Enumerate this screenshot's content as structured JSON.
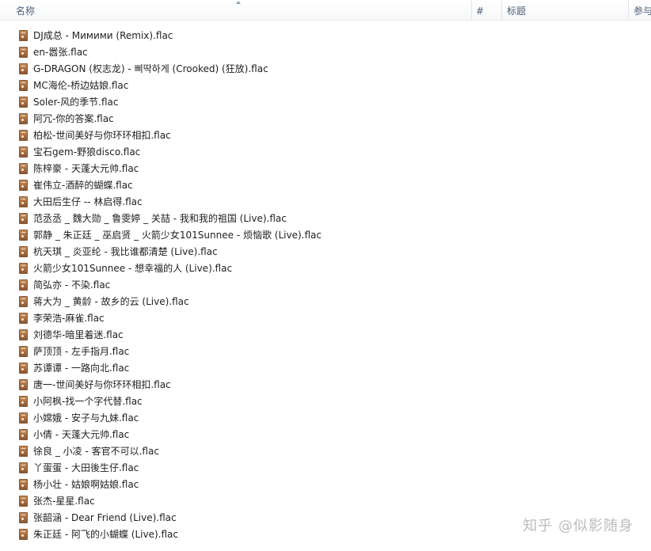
{
  "header": {
    "columns": [
      "名称",
      "#",
      "标题",
      "参与"
    ]
  },
  "files": [
    "DJ成总 - Мимими (Remix).flac",
    "en-嚣张.flac",
    "G-DRAGON (权志龙) - 삐딱하게 (Crooked) (狂放).flac",
    "MC海伦-桥边姑娘.flac",
    "Soler-风的季节.flac",
    "阿冗-你的答案.flac",
    "柏松-世间美好与你环环相扣.flac",
    "宝石gem-野狼disco.flac",
    "陈梓豪 - 天蓬大元帅.flac",
    "崔伟立-酒醉的蝴蝶.flac",
    "大田后生仔 -- 林启得.flac",
    "范丞丞 _ 魏大勋 _ 鲁雯婷 _ 关喆 - 我和我的祖国 (Live).flac",
    "郭静 _ 朱正廷 _ 巫启贤 _ 火箭少女101Sunnee - 烦恼歌 (Live).flac",
    "杭天琪 _ 炎亚纶 - 我比谁都清楚 (Live).flac",
    "火箭少女101Sunnee - 想幸福的人 (Live).flac",
    "简弘亦 - 不染.flac",
    "蒋大为 _ 黄龄 - 故乡的云 (Live).flac",
    "李荣浩-麻雀.flac",
    "刘德华-暗里着迷.flac",
    "萨顶顶 - 左手指月.flac",
    "苏谭谭 - 一路向北.flac",
    "唐一-世间美好与你环环相扣.flac",
    "小阿枫-找一个字代替.flac",
    "小嫦娥 - 安子与九妹.flac",
    "小倩 - 天蓬大元帅.flac",
    "徐良 _ 小凌 - 客官不可以.flac",
    "丫蛋蛋 - 大田後生仔.flac",
    "杨小壮 - 姑娘啊姑娘.flac",
    "张杰-星星.flac",
    "张韶涵 - Dear Friend (Live).flac",
    "朱正廷 - 阿飞的小蝴蝶 (Live).flac"
  ],
  "watermark": "知乎 @似影随身",
  "icon": "flac-audio-file-icon"
}
